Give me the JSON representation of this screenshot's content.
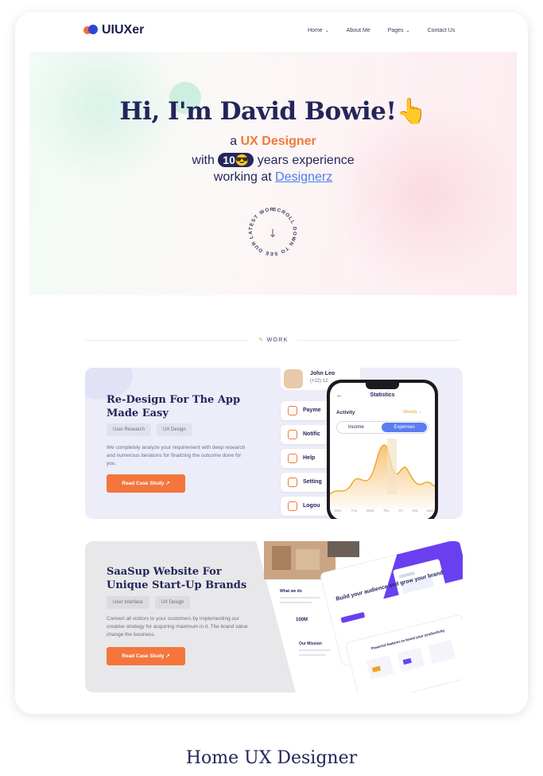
{
  "brand": {
    "name": "UIUXer"
  },
  "nav": {
    "items": [
      {
        "label": "Home",
        "chevron": true
      },
      {
        "label": "About Me",
        "chevron": false
      },
      {
        "label": "Pages",
        "chevron": true
      },
      {
        "label": "Contact Us",
        "chevron": false
      }
    ]
  },
  "hero": {
    "greeting": "Hi, I'm David Bowie!",
    "hand_emoji": "👆",
    "role_prefix": "a",
    "role": "UX Designer",
    "exp_prefix": "with",
    "exp_years": "10",
    "exp_suffix": "years experience",
    "work_prefix": "working at",
    "company": "Designerz",
    "scroll_text": "SCROLL DOWN TO SEE OUR LATEST WORK •",
    "scroll_arrow": "↓"
  },
  "section": {
    "label": "WORK"
  },
  "projects": [
    {
      "title_l1": "Re-Design For The App",
      "title_l2": "Made Easy",
      "tags": [
        "User Research",
        "UX Design"
      ],
      "desc": "We completely analyze your requirement with deep research and numerous iterations for finalizing the outcome done for you.",
      "button": "Read Case Study ↗",
      "mock": {
        "contact_name": "John Leo",
        "contact_phone": "(+22) 12",
        "menu": [
          "Payme",
          "Notific",
          "Help",
          "Setting",
          "Logou"
        ],
        "screen_title": "Statistics",
        "back": "←",
        "activity": "Activity",
        "period": "Weekly ⌄",
        "seg_income": "Income",
        "seg_expenses": "Expenses",
        "days": [
          "Mon",
          "Tue",
          "Wed",
          "Thu",
          "Fri",
          "Sat",
          "Sun"
        ]
      }
    },
    {
      "title_l1": "SaaSup Website For",
      "title_l2": "Unique Start-Up Brands",
      "tags": [
        "User Interface",
        "UX Design"
      ],
      "desc": "Convert all visitors to your customers by implementing our creative strategy for acquiring maximum in it. The brand value change the business.",
      "button": "Read Case Study ↗",
      "mock": {
        "heading": "Build your audience and grow your brand",
        "what": "What we do",
        "stat": "100M",
        "mission": "Our Mission",
        "features": "Powerful features to boost your productivity"
      }
    }
  ],
  "caption": "Home UX Designer",
  "colors": {
    "accent": "#f4763c",
    "navy": "#23265a",
    "link": "#4b7bf0",
    "purple": "#6a3ff0"
  }
}
